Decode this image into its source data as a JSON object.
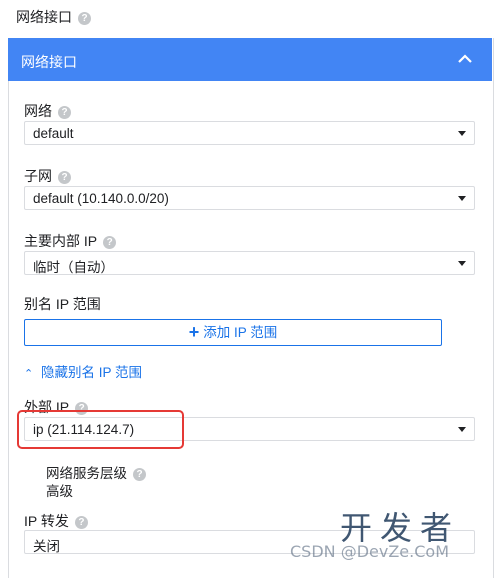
{
  "section": {
    "title": "网络接口"
  },
  "panel": {
    "title": "网络接口"
  },
  "network": {
    "label": "网络",
    "value": "default"
  },
  "subnet": {
    "label": "子网",
    "value": "default (10.140.0.0/20)"
  },
  "internal_ip": {
    "label": "主要内部 IP",
    "value": "临时（自动）"
  },
  "alias": {
    "label": "别名 IP 范围",
    "add_button": "添加 IP 范围",
    "hide_link": "隐藏别名 IP 范围"
  },
  "external_ip": {
    "label": "外部 IP",
    "value": "ip (21.114.124.7)"
  },
  "network_tier": {
    "label": "网络服务层级",
    "value": "高级"
  },
  "ip_forwarding": {
    "label": "IP 转发",
    "value": "关闭"
  },
  "help_glyph": "?",
  "watermark": {
    "main": "开发者",
    "sub": "CSDN @DevZe.CoM"
  },
  "colors": {
    "accent": "#4285f4",
    "link": "#1a73e8",
    "highlight": "#e53935"
  }
}
